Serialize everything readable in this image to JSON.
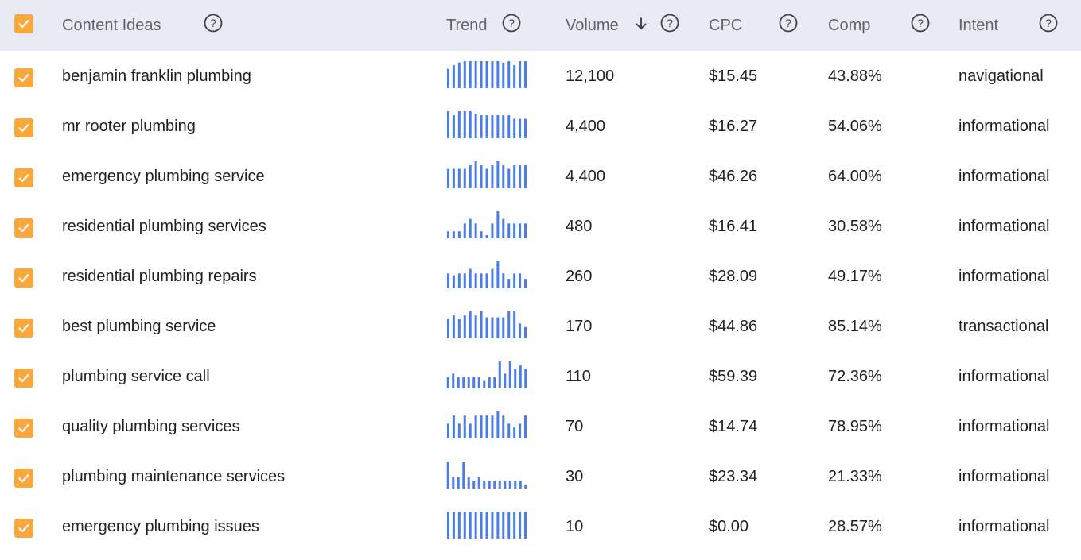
{
  "header": {
    "select_all_checked": true,
    "columns": {
      "content": "Content Ideas",
      "trend": "Trend",
      "volume": "Volume",
      "cpc": "CPC",
      "comp": "Comp",
      "intent": "Intent"
    },
    "volume_sort": "descending"
  },
  "colors": {
    "header_bg": "#e8eaf6",
    "checkbox": "#f9a93b",
    "trend_bar": "#4a7de6"
  },
  "rows": [
    {
      "keyword": "benjamin franklin plumbing",
      "volume": "12,100",
      "cpc": "$15.45",
      "comp": "43.88%",
      "intent": "navigational",
      "checked": true,
      "trend": [
        0.72,
        0.85,
        0.95,
        1.0,
        1.0,
        1.0,
        1.0,
        1.0,
        1.0,
        1.0,
        0.95,
        1.0,
        0.85,
        1.0,
        1.0
      ]
    },
    {
      "keyword": "mr rooter plumbing",
      "volume": "4,400",
      "cpc": "$16.27",
      "comp": "54.06%",
      "intent": "informational",
      "checked": true,
      "trend": [
        1.0,
        0.85,
        1.0,
        1.0,
        1.0,
        0.9,
        0.85,
        0.85,
        0.85,
        0.85,
        0.85,
        0.85,
        0.72,
        0.72,
        0.72
      ]
    },
    {
      "keyword": "emergency plumbing service",
      "volume": "4,400",
      "cpc": "$46.26",
      "comp": "64.00%",
      "intent": "informational",
      "checked": true,
      "trend": [
        0.72,
        0.72,
        0.72,
        0.72,
        0.85,
        1.0,
        0.85,
        0.72,
        0.85,
        1.0,
        0.85,
        0.72,
        0.85,
        0.85,
        0.85
      ]
    },
    {
      "keyword": "residential plumbing services",
      "volume": "480",
      "cpc": "$16.41",
      "comp": "30.58%",
      "intent": "informational",
      "checked": true,
      "trend": [
        0.26,
        0.26,
        0.26,
        0.55,
        0.72,
        0.55,
        0.26,
        0.12,
        0.55,
        1.0,
        0.72,
        0.55,
        0.55,
        0.55,
        0.55
      ]
    },
    {
      "keyword": "residential plumbing repairs",
      "volume": "260",
      "cpc": "$28.09",
      "comp": "49.17%",
      "intent": "informational",
      "checked": true,
      "trend": [
        0.55,
        0.48,
        0.55,
        0.55,
        0.72,
        0.55,
        0.55,
        0.55,
        0.72,
        1.0,
        0.55,
        0.35,
        0.55,
        0.55,
        0.35
      ]
    },
    {
      "keyword": "best plumbing service",
      "volume": "170",
      "cpc": "$44.86",
      "comp": "85.14%",
      "intent": "transactional",
      "checked": true,
      "trend": [
        0.72,
        0.85,
        0.72,
        0.85,
        1.0,
        0.85,
        1.0,
        0.78,
        0.78,
        0.78,
        0.78,
        1.0,
        1.0,
        0.55,
        0.42
      ]
    },
    {
      "keyword": "plumbing service call",
      "volume": "110",
      "cpc": "$59.39",
      "comp": "72.36%",
      "intent": "informational",
      "checked": true,
      "trend": [
        0.42,
        0.55,
        0.42,
        0.42,
        0.42,
        0.42,
        0.42,
        0.28,
        0.42,
        0.42,
        1.0,
        0.55,
        1.0,
        0.72,
        0.85,
        0.72
      ]
    },
    {
      "keyword": "quality plumbing services",
      "volume": "70",
      "cpc": "$14.74",
      "comp": "78.95%",
      "intent": "informational",
      "checked": true,
      "trend": [
        0.55,
        0.85,
        0.55,
        0.85,
        0.55,
        0.85,
        0.85,
        0.85,
        0.85,
        1.0,
        0.85,
        0.55,
        0.42,
        0.55,
        0.85
      ]
    },
    {
      "keyword": "plumbing maintenance services",
      "volume": "30",
      "cpc": "$23.34",
      "comp": "21.33%",
      "intent": "informational",
      "checked": true,
      "trend": [
        1.0,
        0.42,
        0.42,
        1.0,
        0.42,
        0.28,
        0.42,
        0.28,
        0.28,
        0.28,
        0.28,
        0.28,
        0.28,
        0.28,
        0.28,
        0.15
      ]
    },
    {
      "keyword": "emergency plumbing issues",
      "volume": "10",
      "cpc": "$0.00",
      "comp": "28.57%",
      "intent": "informational",
      "checked": true,
      "trend": [
        1.0,
        1.0,
        1.0,
        1.0,
        1.0,
        1.0,
        1.0,
        1.0,
        1.0,
        1.0,
        1.0,
        1.0,
        1.0,
        1.0,
        1.0
      ]
    }
  ]
}
